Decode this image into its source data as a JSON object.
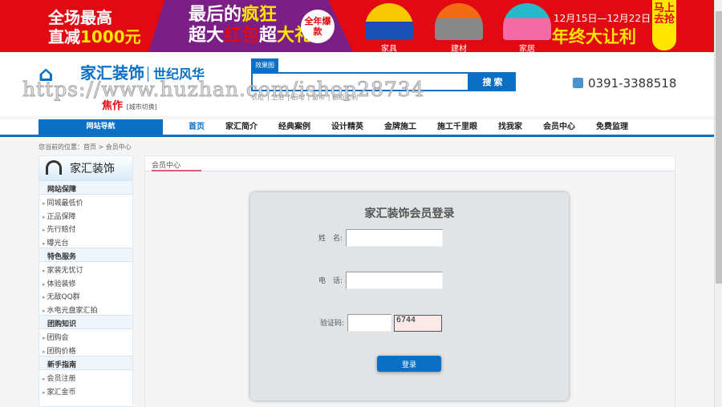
{
  "banner": {
    "promo1_line1": "全场最高",
    "promo1_line2_a": "直减",
    "promo1_line2_b": "1000元",
    "promo2_line1_a": "最后的",
    "promo2_line1_b": "疯狂",
    "promo2_line2_a": "超大",
    "promo2_line2_b": "红包",
    "promo2_line2_c": "超",
    "promo2_line2_d": "大礼",
    "badge": "全年爆款",
    "products": [
      "家具",
      "建材",
      "家居"
    ],
    "date_range": "12月15日—12月22日",
    "sale_title": "年终大让利",
    "grab": "马上去抢"
  },
  "header": {
    "logo": "家汇装饰",
    "slogan": "世纪风华",
    "city": "焦作",
    "city_switch": "[城市切换]",
    "search_tab": "效果图",
    "search_placeholder": "",
    "search_button": "搜 索",
    "tags": [
      "衣柜",
      "卫浴",
      "厨电",
      "窗帘",
      "橱柜定制"
    ],
    "phone": "0391-3388518"
  },
  "nav": {
    "heading": "网站导航",
    "items": [
      "首页",
      "家汇简介",
      "经典案例",
      "设计精英",
      "金牌施工",
      "施工千里眼",
      "找我家",
      "会员中心",
      "免费监理"
    ]
  },
  "breadcrumb": "您当前的位置：首页 > 会员中心",
  "sidebar": {
    "title": "家汇装饰",
    "groups": [
      {
        "title": "网站保障",
        "items": [
          "同城最低价",
          "正品保障",
          "先行赔付",
          "曝光台"
        ]
      },
      {
        "title": "特色服务",
        "items": [
          "家装无忧订",
          "体验装修",
          "无敌QQ群",
          "水电光盘家汇拍"
        ]
      },
      {
        "title": "团购知识",
        "items": [
          "团购会",
          "团购价格"
        ]
      },
      {
        "title": "新手指南",
        "items": [
          "会员注册",
          "家汇金币"
        ]
      }
    ]
  },
  "main": {
    "tab": "会员中心",
    "login": {
      "title": "家汇装饰会员登录",
      "name_label": "姓　名:",
      "phone_label": "电　话:",
      "code_label": "验证码:",
      "captcha": "6744",
      "submit": "登录"
    }
  },
  "watermark": "https://www.huzhan.com/ishop28734"
}
